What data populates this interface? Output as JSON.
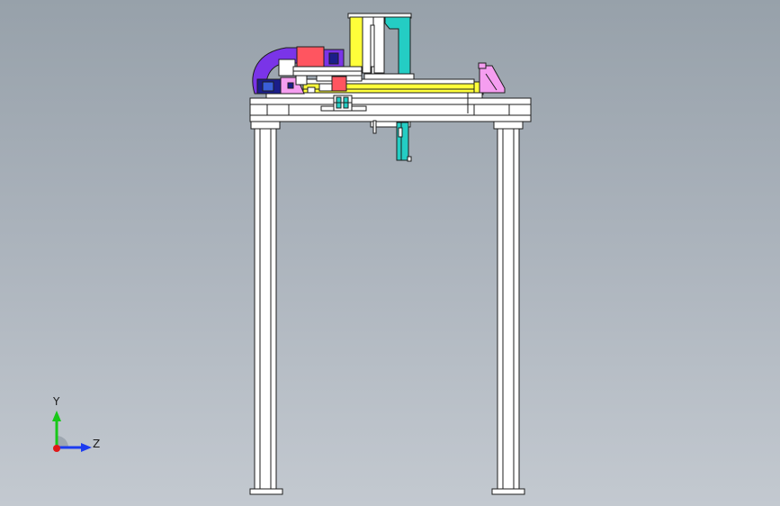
{
  "viewport": {
    "background_top": "#97a1aa",
    "background_bottom": "#c3c9d0"
  },
  "model": {
    "frame_color": "#ffffff",
    "edge_color": "#1e1e1e",
    "colors": {
      "yellow": "#ffff3a",
      "cyan": "#24cdc4",
      "purple": "#7a34e8",
      "pink": "#f59ef0",
      "red": "#ff5560",
      "navy": "#1b1d8a",
      "blue_connector": "#3a5fd8"
    }
  },
  "triad": {
    "y_label": "Y",
    "z_label": "Z",
    "y_color": "#18c818",
    "z_color": "#1d3cf0",
    "x_color": "#e01818"
  }
}
